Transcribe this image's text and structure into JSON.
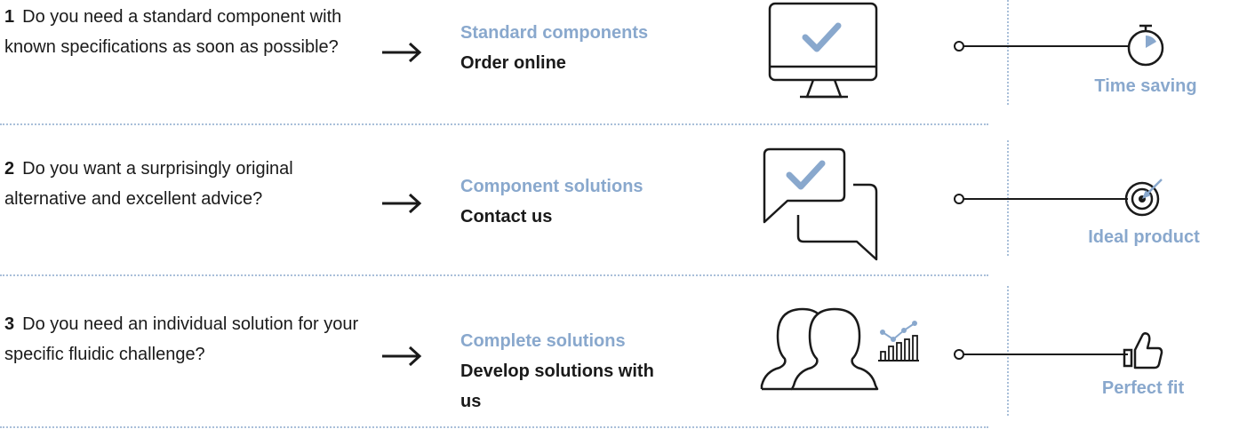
{
  "colors": {
    "accent": "#89a8cd",
    "text": "#1a1a1a",
    "separator": "#a9bfd9"
  },
  "rows": [
    {
      "number": "1",
      "question": "Do you need a standard component with known specifications as soon as possible?",
      "solution_title": "Standard components",
      "action": "Order online",
      "illustration_icon": "monitor-check-icon",
      "benefit_icon": "stopwatch-icon",
      "benefit": "Time saving"
    },
    {
      "number": "2",
      "question": "Do you want a surprisingly original alternative and excellent advice?",
      "solution_title": "Component solutions",
      "action": "Contact us",
      "illustration_icon": "chat-bubbles-check-icon",
      "benefit_icon": "target-icon",
      "benefit": "Ideal product"
    },
    {
      "number": "3",
      "question": "Do you need an individual solution for your specific fluidic challenge?",
      "solution_title": "Complete solutions",
      "action": "Develop solutions with us",
      "illustration_icon": "people-chart-icon",
      "benefit_icon": "thumbs-up-icon",
      "benefit": "Perfect fit"
    }
  ]
}
